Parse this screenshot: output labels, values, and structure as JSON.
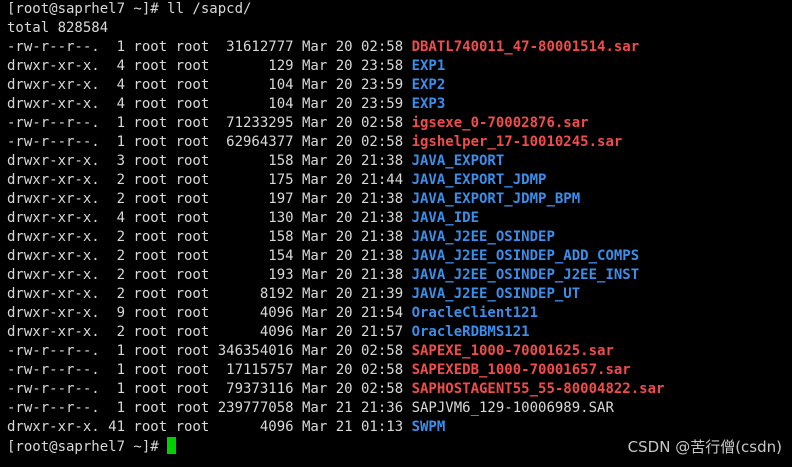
{
  "terminal": {
    "command_prompt": "[root@saprhel7 ~]# ll /sapcd/",
    "total_line": "total 828584",
    "entries": [
      {
        "meta": "-rw-r--r--.  1 root root  31612777 Mar 20 02:58 ",
        "name": "DBATL740011_47-80001514.sar",
        "kind": "archive"
      },
      {
        "meta": "drwxr-xr-x.  4 root root       129 Mar 20 23:58 ",
        "name": "EXP1",
        "kind": "dir"
      },
      {
        "meta": "drwxr-xr-x.  4 root root       104 Mar 20 23:59 ",
        "name": "EXP2",
        "kind": "dir"
      },
      {
        "meta": "drwxr-xr-x.  4 root root       104 Mar 20 23:59 ",
        "name": "EXP3",
        "kind": "dir"
      },
      {
        "meta": "-rw-r--r--.  1 root root  71233295 Mar 20 02:58 ",
        "name": "igsexe_0-70002876.sar",
        "kind": "archive"
      },
      {
        "meta": "-rw-r--r--.  1 root root  62964377 Mar 20 02:58 ",
        "name": "igshelper_17-10010245.sar",
        "kind": "archive"
      },
      {
        "meta": "drwxr-xr-x.  3 root root       158 Mar 20 21:38 ",
        "name": "JAVA_EXPORT",
        "kind": "dir"
      },
      {
        "meta": "drwxr-xr-x.  2 root root       175 Mar 20 21:44 ",
        "name": "JAVA_EXPORT_JDMP",
        "kind": "dir"
      },
      {
        "meta": "drwxr-xr-x.  2 root root       197 Mar 20 21:38 ",
        "name": "JAVA_EXPORT_JDMP_BPM",
        "kind": "dir"
      },
      {
        "meta": "drwxr-xr-x.  4 root root       130 Mar 20 21:38 ",
        "name": "JAVA_IDE",
        "kind": "dir"
      },
      {
        "meta": "drwxr-xr-x.  2 root root       158 Mar 20 21:38 ",
        "name": "JAVA_J2EE_OSINDEP",
        "kind": "dir"
      },
      {
        "meta": "drwxr-xr-x.  2 root root       154 Mar 20 21:38 ",
        "name": "JAVA_J2EE_OSINDEP_ADD_COMPS",
        "kind": "dir"
      },
      {
        "meta": "drwxr-xr-x.  2 root root       193 Mar 20 21:38 ",
        "name": "JAVA_J2EE_OSINDEP_J2EE_INST",
        "kind": "dir"
      },
      {
        "meta": "drwxr-xr-x.  2 root root      8192 Mar 20 21:39 ",
        "name": "JAVA_J2EE_OSINDEP_UT",
        "kind": "dir"
      },
      {
        "meta": "drwxr-xr-x.  9 root root      4096 Mar 20 21:54 ",
        "name": "OracleClient121",
        "kind": "dir"
      },
      {
        "meta": "drwxr-xr-x.  2 root root      4096 Mar 20 21:57 ",
        "name": "OracleRDBMS121",
        "kind": "dir"
      },
      {
        "meta": "-rw-r--r--.  1 root root 346354016 Mar 20 02:58 ",
        "name": "SAPEXE_1000-70001625.sar",
        "kind": "archive"
      },
      {
        "meta": "-rw-r--r--.  1 root root  17115757 Mar 20 02:58 ",
        "name": "SAPEXEDB_1000-70001657.sar",
        "kind": "archive"
      },
      {
        "meta": "-rw-r--r--.  1 root root  79373116 Mar 20 02:58 ",
        "name": "SAPHOSTAGENT55_55-80004822.sar",
        "kind": "archive"
      },
      {
        "meta": "-rw-r--r--.  1 root root 239777058 Mar 21 21:36 ",
        "name": "SAPJVM6_129-10006989.SAR",
        "kind": "plain"
      },
      {
        "meta": "drwxr-xr-x. 41 root root      4096 Mar 21 01:13 ",
        "name": "SWPM",
        "kind": "dir"
      }
    ],
    "final_prompt": "[root@saprhel7 ~]# "
  },
  "watermark": "CSDN @苦行僧(csdn)",
  "colors": {
    "background": "#000000",
    "foreground": "#d9d9d9",
    "directory": "#3b8eea",
    "archive": "#f14c4c",
    "cursor": "#00d000"
  }
}
